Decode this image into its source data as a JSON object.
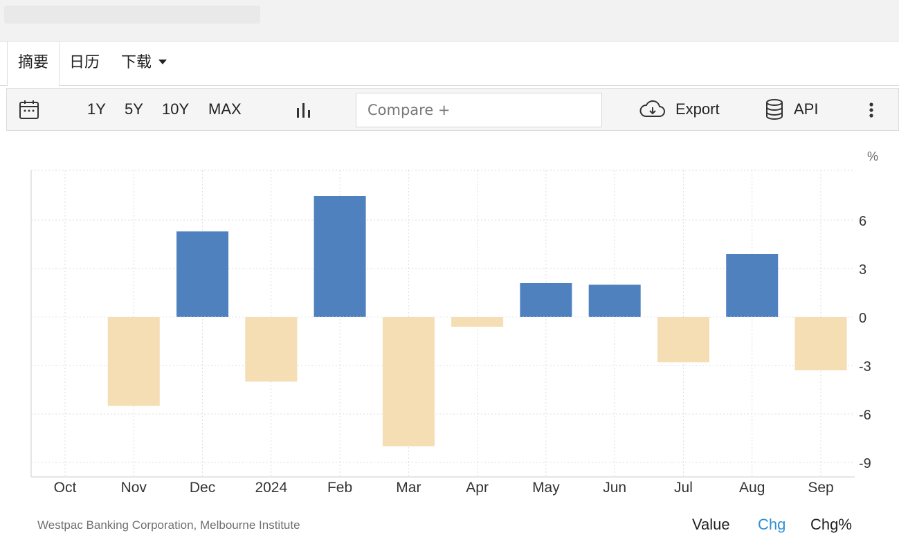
{
  "tabs": {
    "summary": "摘要",
    "calendar": "日历",
    "download": "下载"
  },
  "toolbar": {
    "ranges": [
      "1Y",
      "5Y",
      "10Y",
      "MAX"
    ],
    "compare_placeholder": "Compare +",
    "export_label": "Export",
    "api_label": "API"
  },
  "footer": {
    "source": "Westpac Banking Corporation, Melbourne Institute",
    "modes": {
      "value": "Value",
      "chg": "Chg",
      "chg_pct": "Chg%"
    }
  },
  "colors": {
    "positive": "#4e81bd",
    "negative": "#f5deb3",
    "active_mode": "#2f8fd6"
  },
  "chart_data": {
    "type": "bar",
    "title": "",
    "unit": "%",
    "categories": [
      "Oct",
      "Nov",
      "Dec",
      "2024",
      "Feb",
      "Mar",
      "Apr",
      "May",
      "Jun",
      "Jul",
      "Aug",
      "Sep"
    ],
    "values": [
      0,
      -5.5,
      5.3,
      -4.0,
      7.5,
      -8.0,
      -0.6,
      2.1,
      2.0,
      -2.8,
      3.9,
      -3.3
    ],
    "ylim": [
      -10,
      9
    ],
    "yticks": [
      6,
      3,
      0,
      -3,
      -6,
      -9
    ],
    "ytick_labels": [
      "6",
      "3",
      "0",
      "-3",
      "-6",
      "-9"
    ],
    "y_axis_side": "right",
    "grid": true
  }
}
